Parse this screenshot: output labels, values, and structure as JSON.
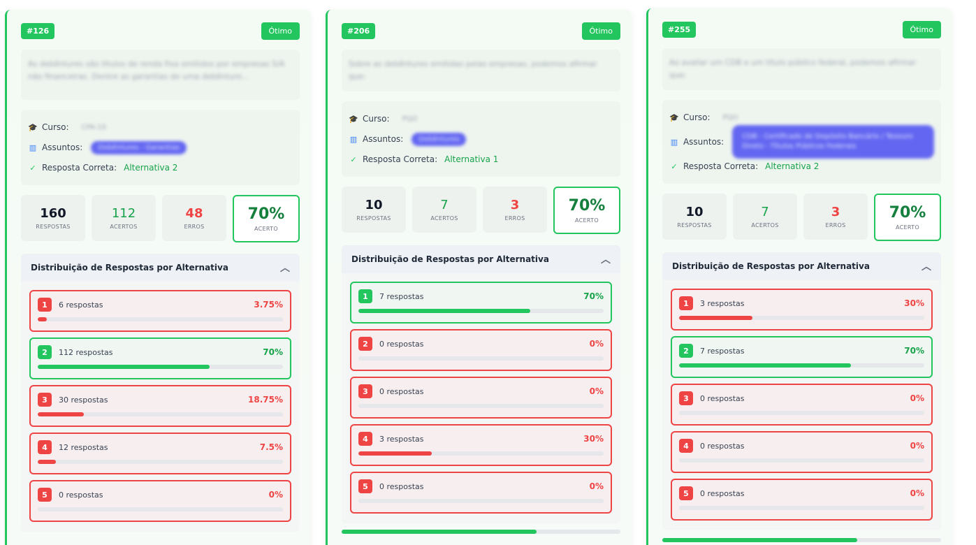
{
  "labels": {
    "curso": "Curso:",
    "assuntos": "Assuntos:",
    "resposta_correta": "Resposta Correta:",
    "respostas": "RESPOSTAS",
    "acertos": "ACERTOS",
    "erros": "ERROS",
    "acerto": "ACERTO",
    "distribuicao": "Distribuição de Respostas por Alternativa"
  },
  "colors": {
    "accent_green": "#22c55e",
    "error_red": "#ef4444",
    "subject_purple": "#6366f1"
  },
  "icons": {
    "curso": "graduation-cap-icon",
    "assuntos": "book-open-icon",
    "correta": "check-circle-icon",
    "collapse": "chevron-up-icon"
  },
  "cards": [
    {
      "id": "#126",
      "rating": "Ótimo",
      "question": "As debêntures são títulos de renda fixa emitidos por empresas S/A não financeiras. Dentre as garantias de uma debênture...",
      "curso": "CPA-10",
      "assuntos": "Debêntures - Garantias",
      "correct": "Alternativa 2",
      "respostas": "160",
      "acertos": "112",
      "erros": "48",
      "pct": "70%",
      "progress": 0.7,
      "alternatives": [
        {
          "num": "1",
          "count": "6 respostas",
          "pct": "3.75%",
          "fill": 0.0375,
          "correct": false
        },
        {
          "num": "2",
          "count": "112 respostas",
          "pct": "70%",
          "fill": 0.7,
          "correct": true
        },
        {
          "num": "3",
          "count": "30 respostas",
          "pct": "18.75%",
          "fill": 0.1875,
          "correct": false
        },
        {
          "num": "4",
          "count": "12 respostas",
          "pct": "7.5%",
          "fill": 0.075,
          "correct": false
        },
        {
          "num": "5",
          "count": "0 respostas",
          "pct": "0%",
          "fill": 0,
          "correct": false
        }
      ]
    },
    {
      "id": "#206",
      "rating": "Ótimo",
      "question": "Sobre as debêntures emitidas pelas empresas, podemos afirmar que:",
      "curso": "PQO",
      "assuntos": "Debêntures",
      "correct": "Alternativa 1",
      "respostas": "10",
      "acertos": "7",
      "erros": "3",
      "pct": "70%",
      "progress": 0.7,
      "alternatives": [
        {
          "num": "1",
          "count": "7 respostas",
          "pct": "70%",
          "fill": 0.7,
          "correct": true
        },
        {
          "num": "2",
          "count": "0 respostas",
          "pct": "0%",
          "fill": 0,
          "correct": false
        },
        {
          "num": "3",
          "count": "0 respostas",
          "pct": "0%",
          "fill": 0,
          "correct": false
        },
        {
          "num": "4",
          "count": "3 respostas",
          "pct": "30%",
          "fill": 0.3,
          "correct": false
        },
        {
          "num": "5",
          "count": "0 respostas",
          "pct": "0%",
          "fill": 0,
          "correct": false
        }
      ]
    },
    {
      "id": "#255",
      "rating": "Ótimo",
      "question": "Ao avaliar um CDB e um título público federal, podemos afirmar que:",
      "curso": "PQO",
      "assuntos": "CDB - Certificado de Depósito Bancário / Tesouro Direto - Títulos Públicos Federais",
      "correct": "Alternativa 2",
      "respostas": "10",
      "acertos": "7",
      "erros": "3",
      "pct": "70%",
      "progress": 0.7,
      "alternatives": [
        {
          "num": "1",
          "count": "3 respostas",
          "pct": "30%",
          "fill": 0.3,
          "correct": false
        },
        {
          "num": "2",
          "count": "7 respostas",
          "pct": "70%",
          "fill": 0.7,
          "correct": true
        },
        {
          "num": "3",
          "count": "0 respostas",
          "pct": "0%",
          "fill": 0,
          "correct": false
        },
        {
          "num": "4",
          "count": "0 respostas",
          "pct": "0%",
          "fill": 0,
          "correct": false
        },
        {
          "num": "5",
          "count": "0 respostas",
          "pct": "0%",
          "fill": 0,
          "correct": false
        }
      ]
    }
  ]
}
